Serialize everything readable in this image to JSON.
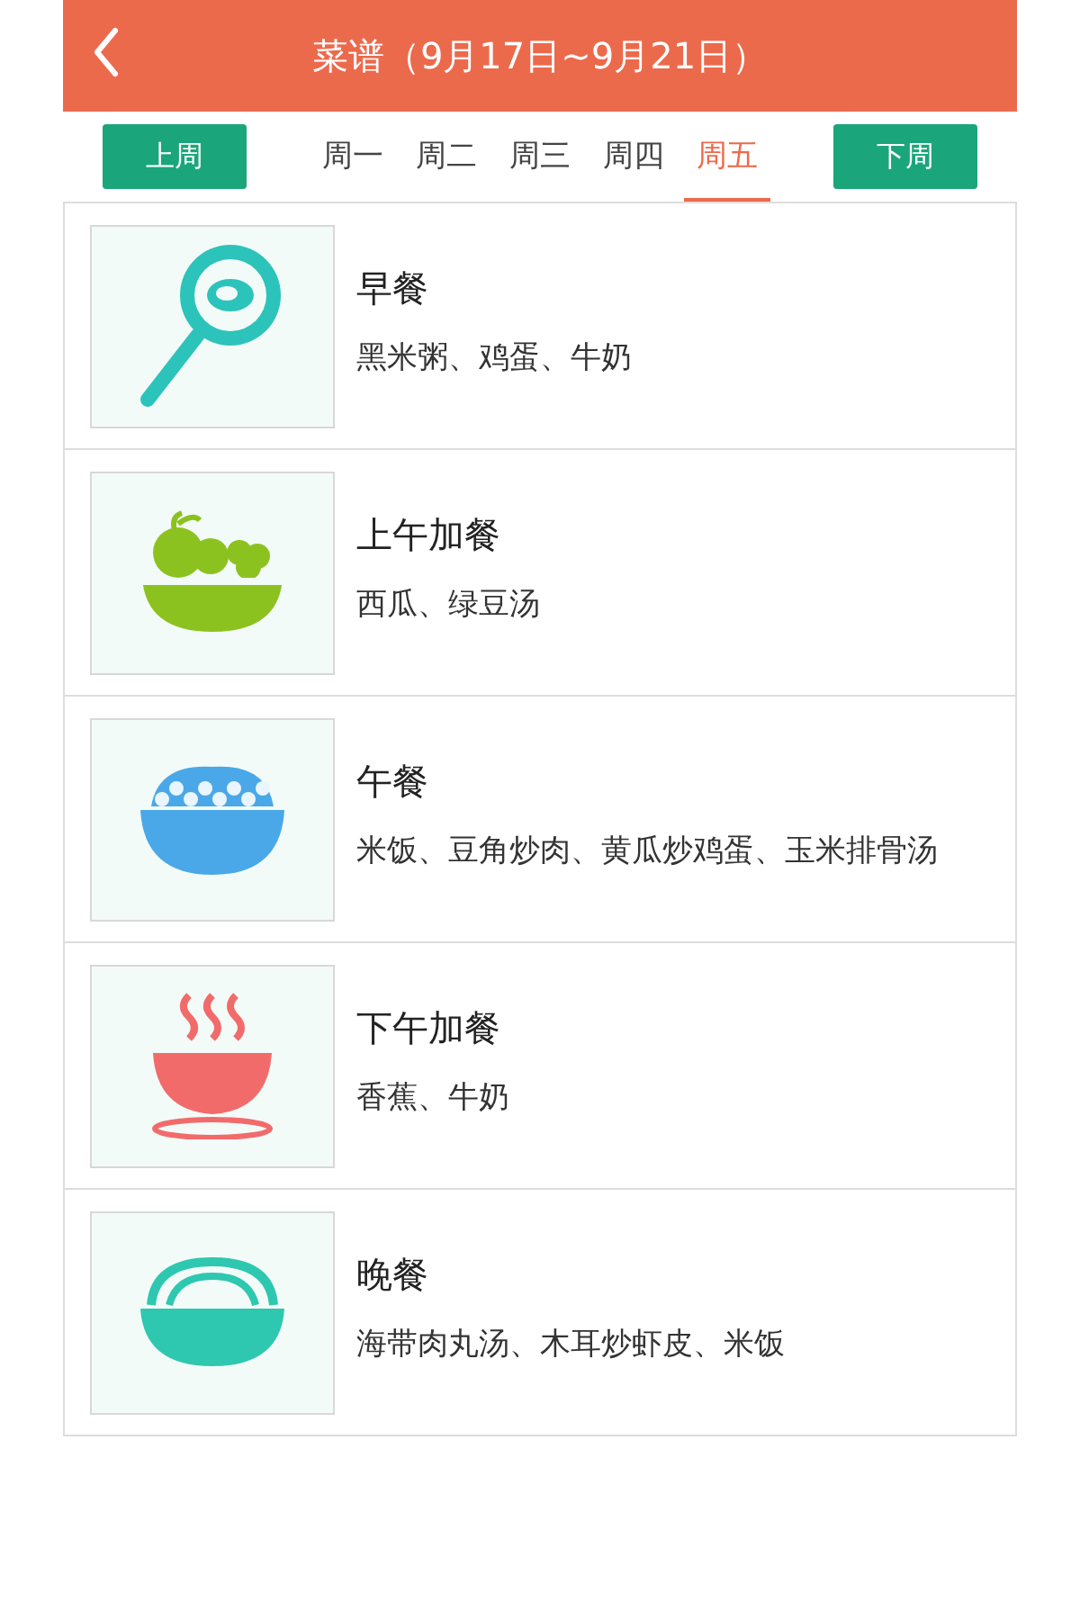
{
  "header": {
    "title": "菜谱（9月17日~9月21日）"
  },
  "week_nav": {
    "prev": "上周",
    "next": "下周"
  },
  "days": [
    {
      "label": "周一",
      "selected": false
    },
    {
      "label": "周二",
      "selected": false
    },
    {
      "label": "周三",
      "selected": false
    },
    {
      "label": "周四",
      "selected": false
    },
    {
      "label": "周五",
      "selected": true
    }
  ],
  "meals": [
    {
      "kind": "pan",
      "name": "早餐",
      "dishes": "黑米粥、鸡蛋、牛奶"
    },
    {
      "kind": "fruit",
      "name": "上午加餐",
      "dishes": "西瓜、绿豆汤"
    },
    {
      "kind": "rice",
      "name": "午餐",
      "dishes": "米饭、豆角炒肉、黄瓜炒鸡蛋、玉米排骨汤"
    },
    {
      "kind": "soup",
      "name": "下午加餐",
      "dishes": "香蕉、牛奶"
    },
    {
      "kind": "noodle",
      "name": "晚餐",
      "dishes": "海带肉丸汤、木耳炒虾皮、米饭"
    }
  ]
}
